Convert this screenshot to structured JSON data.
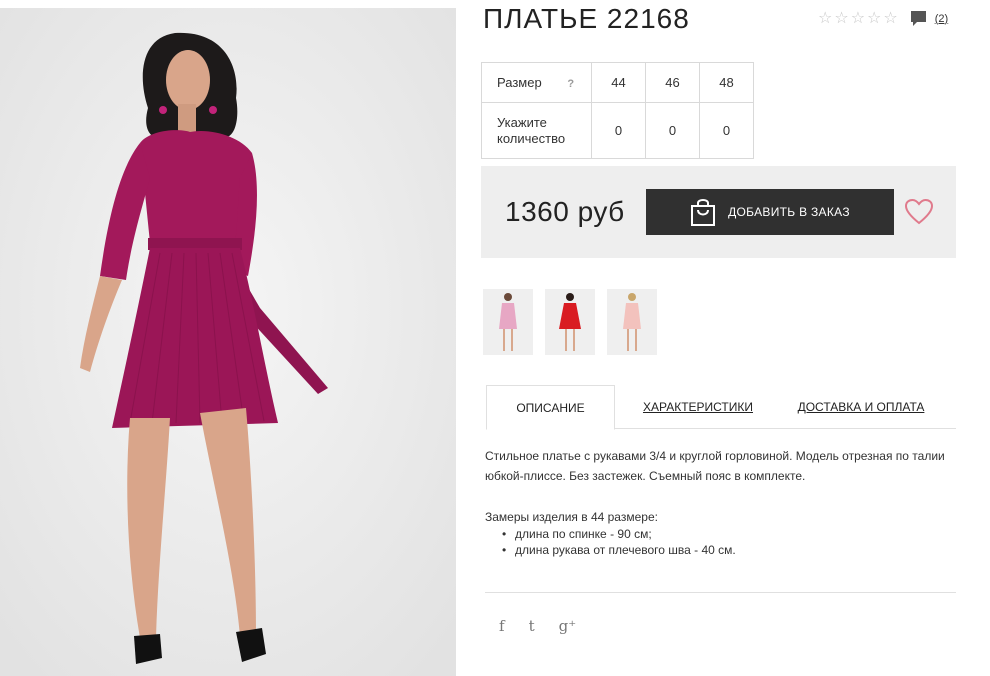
{
  "product": {
    "title": "ПЛАТЬЕ 22168",
    "rating_stars": 5,
    "review_count": "(2)"
  },
  "sizes": {
    "size_label": "Размер",
    "help": "?",
    "values": [
      "44",
      "46",
      "48"
    ],
    "quantity_label": "Укажите количество",
    "quantities": [
      "0",
      "0",
      "0"
    ]
  },
  "buy": {
    "price": "1360 руб",
    "add_label": "ДОБАВИТЬ В ЗАКАЗ"
  },
  "thumbnails": [
    {
      "icon": "pink-dress-thumbnail",
      "color": "#e7a7c4"
    },
    {
      "icon": "red-dress-thumbnail",
      "color": "#d91c22"
    },
    {
      "icon": "peach-dress-thumbnail",
      "color": "#f3c2bd"
    }
  ],
  "tabs": {
    "description": "ОПИСАНИЕ",
    "characteristics": "ХАРАКТЕРИСТИКИ",
    "delivery": "ДОСТАВКА И ОПЛАТА"
  },
  "description": {
    "text": "Стильное платье с рукавами 3/4 и круглой горловиной. Модель отрезная по талии юбкой-плиссе. Без застежек. Съемный пояс в комплекте.",
    "measures_title": "Замеры изделия в 44 размере:",
    "measures": [
      "длина по спинке - 90 см;",
      "длина рукава от плечевого шва - 40 см."
    ]
  },
  "social": {
    "facebook": "f",
    "twitter": "t",
    "googleplus": "g⁺"
  },
  "colors": {
    "dress": "#a3195b",
    "button": "#303030",
    "heart": "#e07a8c",
    "star_empty": "#c8c8c8"
  }
}
